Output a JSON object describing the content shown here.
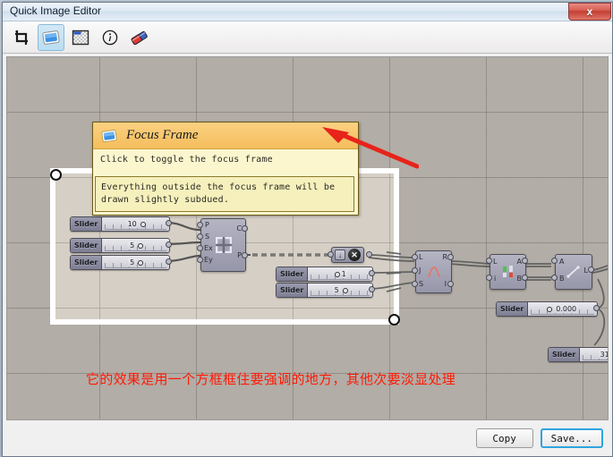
{
  "window": {
    "title": "Quick Image Editor",
    "close_label": "x"
  },
  "toolbar": {
    "items": [
      {
        "name": "crop-tool",
        "label": "Crop",
        "active": false
      },
      {
        "name": "focus-frame-tool",
        "label": "Focus Frame",
        "active": true
      },
      {
        "name": "transparency-tool",
        "label": "Transparency",
        "active": false
      },
      {
        "name": "info-tool",
        "label": "Info",
        "active": false
      },
      {
        "name": "eraser-tool",
        "label": "Eraser",
        "active": false
      }
    ]
  },
  "tooltip": {
    "title": "Focus Frame",
    "description": "Click to toggle the focus frame",
    "note": "Everything outside the focus frame will be drawn slightly subdued."
  },
  "canvas": {
    "caption": "它的效果是用一个方框框住要强调的地方，其他次要淡显处理",
    "caption_color": "#fd1a07",
    "arrow_color": "#e8231a",
    "focus_frame": {
      "handle_top_left": "resize-handle",
      "handle_bottom_right": "resize-handle"
    },
    "sliders": [
      {
        "label": "Slider",
        "value": "10"
      },
      {
        "label": "Slider",
        "value": "5"
      },
      {
        "label": "Slider",
        "value": "5"
      },
      {
        "label": "Slider",
        "value": "1"
      },
      {
        "label": "Slider",
        "value": "5"
      },
      {
        "label": "Slider",
        "value": "0.000"
      },
      {
        "label": "Slider",
        "value": "31"
      }
    ],
    "components": [
      {
        "name": "rectangular-grid",
        "inputs": [
          "P",
          "S",
          "Ex",
          "Ey"
        ],
        "outputs": [
          "C",
          "P"
        ]
      },
      {
        "name": "graph-mapper",
        "inputs": [
          "L",
          "J",
          "S"
        ],
        "outputs": [
          "R",
          "I"
        ]
      },
      {
        "name": "list-item",
        "inputs": [
          "L",
          "i"
        ],
        "outputs": [
          "A",
          "B"
        ]
      },
      {
        "name": "line-component",
        "inputs": [
          "A",
          "B"
        ],
        "outputs": [
          "L"
        ]
      }
    ],
    "widget": {
      "download_label": "↓",
      "close_label": "✕"
    }
  },
  "footer": {
    "copy_label": "Copy",
    "save_label": "Save..."
  }
}
